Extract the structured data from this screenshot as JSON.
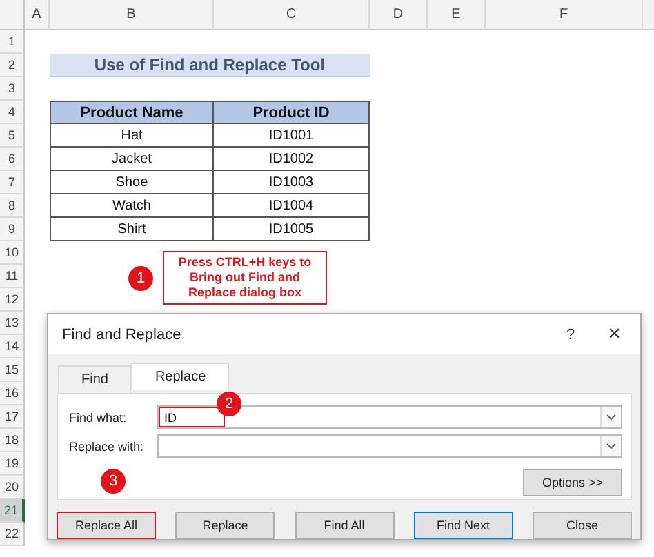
{
  "sheet": {
    "column_headers": [
      "A",
      "B",
      "C",
      "D",
      "E",
      "F"
    ],
    "row_numbers": [
      {
        "label": "1",
        "selected": false
      },
      {
        "label": "2",
        "selected": false
      },
      {
        "label": "3",
        "selected": false
      },
      {
        "label": "4",
        "selected": false
      },
      {
        "label": "5",
        "selected": false
      },
      {
        "label": "6",
        "selected": false
      },
      {
        "label": "7",
        "selected": false
      },
      {
        "label": "8",
        "selected": false
      },
      {
        "label": "9",
        "selected": false
      },
      {
        "label": "10",
        "selected": false
      },
      {
        "label": "11",
        "selected": false
      },
      {
        "label": "12",
        "selected": false
      },
      {
        "label": "13",
        "selected": false
      },
      {
        "label": "14",
        "selected": false
      },
      {
        "label": "15",
        "selected": false
      },
      {
        "label": "16",
        "selected": false
      },
      {
        "label": "17",
        "selected": false
      },
      {
        "label": "18",
        "selected": false
      },
      {
        "label": "19",
        "selected": false
      },
      {
        "label": "20",
        "selected": false
      },
      {
        "label": "21",
        "selected": true
      },
      {
        "label": "22",
        "selected": false
      }
    ],
    "title": "Use of Find and Replace Tool",
    "table": {
      "columns": [
        "Product Name",
        "Product ID"
      ],
      "rows": [
        [
          "Hat",
          "ID1001"
        ],
        [
          "Jacket",
          "ID1002"
        ],
        [
          "Shoe",
          "ID1003"
        ],
        [
          "Watch",
          "ID1004"
        ],
        [
          "Shirt",
          "ID1005"
        ]
      ]
    }
  },
  "note": "Press CTRL+H keys to Bring out Find and Replace dialog box",
  "steps": [
    "1",
    "2",
    "3"
  ],
  "dialog": {
    "title": "Find and Replace",
    "help": "?",
    "close": "×",
    "tabs": [
      {
        "label": "Find",
        "selected": false
      },
      {
        "label": "Replace",
        "selected": true
      }
    ],
    "fields": [
      {
        "label": "Find what:",
        "value": "ID",
        "highlighted": true
      },
      {
        "label": "Replace with:",
        "highlighted": false
      }
    ],
    "options_button": "Options >>",
    "buttons": [
      {
        "label": "Replace All",
        "highlighted": true,
        "default": false
      },
      {
        "label": "Replace",
        "highlighted": false,
        "default": false
      },
      {
        "label": "Find All",
        "highlighted": false,
        "default": false
      },
      {
        "label": "Find Next",
        "highlighted": false,
        "default": true
      },
      {
        "label": "Close",
        "highlighted": false,
        "default": false
      }
    ]
  }
}
